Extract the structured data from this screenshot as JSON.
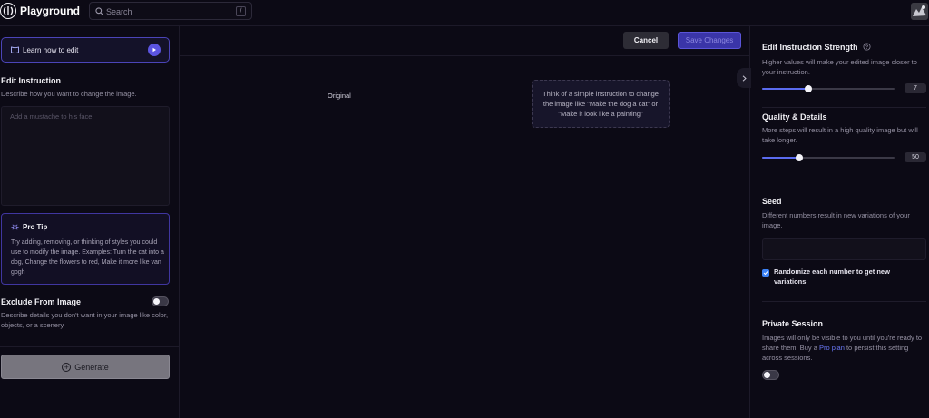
{
  "header": {
    "brand": "Playground",
    "search_placeholder": "Search",
    "search_shortcut": "/"
  },
  "left_panel": {
    "learn_label": "Learn how to edit",
    "edit_instruction": {
      "title": "Edit Instruction",
      "description": "Describe how you want to change the image.",
      "placeholder": "Add a mustache to his face"
    },
    "pro_tip": {
      "title": "Pro Tip",
      "body": "Try adding, removing, or thinking of styles you could use to modify the image. Examples: Turn the cat into a dog, Change the flowers to red, Make it more like van gogh"
    },
    "exclude": {
      "title": "Exclude From Image",
      "description": "Describe details you don't want in your image like color, objects, or a scenery.",
      "enabled": false
    },
    "generate_label": "Generate"
  },
  "center": {
    "cancel_label": "Cancel",
    "save_label": "Save Changes",
    "original_label": "Original",
    "hint": "Think of a simple instruction to change the image like \"Make the dog a cat\" or \"Make it look like a painting\""
  },
  "right_panel": {
    "strength": {
      "title": "Edit Instruction Strength",
      "description": "Higher values will make your edited image closer to your instruction.",
      "value": "7",
      "fraction": 0.35
    },
    "quality": {
      "title": "Quality & Details",
      "description": "More steps will result in a high quality image but will take longer.",
      "value": "50",
      "fraction": 0.28
    },
    "seed": {
      "title": "Seed",
      "description": "Different numbers result in new variations of your image.",
      "value": "",
      "randomize_label": "Randomize each number to get new variations",
      "randomize_checked": true
    },
    "private_session": {
      "title": "Private Session",
      "desc_before": "Images will only be visible to you until you're ready to share them. Buy a ",
      "link_text": "Pro plan",
      "desc_after": " to persist this setting across sessions.",
      "enabled": false
    }
  },
  "colors": {
    "background": "#0c0a15",
    "accent": "#5b54e0",
    "slider": "#5b6cf0",
    "link": "#6a78f5"
  }
}
